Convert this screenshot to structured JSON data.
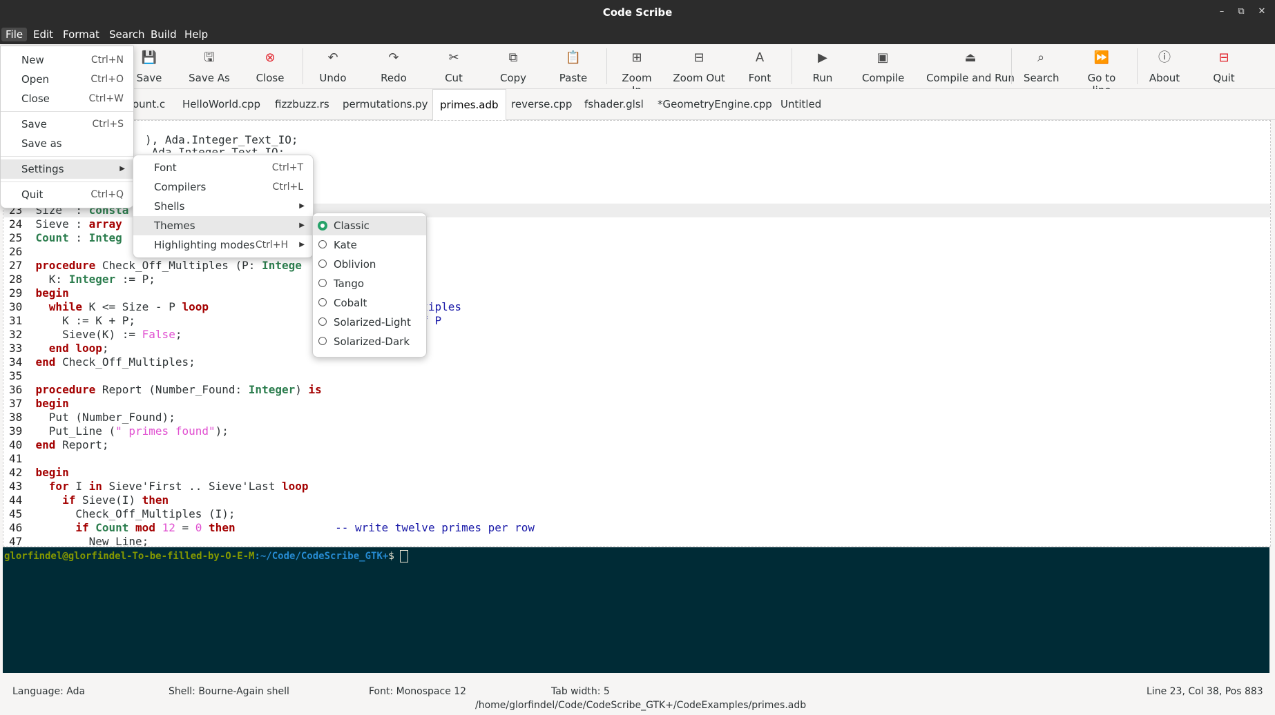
{
  "window": {
    "title": "Code Scribe",
    "minimize": "–",
    "maximize": "⧉",
    "close": "✕"
  },
  "menubar": [
    "File",
    "Edit",
    "Format",
    "Search",
    "Build",
    "Help"
  ],
  "toolbar": [
    {
      "label": "Save",
      "icon": "💾"
    },
    {
      "label": "Save As",
      "icon": "🖫"
    },
    {
      "label": "Close",
      "icon": "⊗"
    },
    {
      "label": "Undo",
      "icon": "↶"
    },
    {
      "label": "Redo",
      "icon": "↷"
    },
    {
      "label": "Cut",
      "icon": "✂"
    },
    {
      "label": "Copy",
      "icon": "⧉"
    },
    {
      "label": "Paste",
      "icon": "📋"
    },
    {
      "label": "Zoom In",
      "icon": "⊞"
    },
    {
      "label": "Zoom Out",
      "icon": "⊟"
    },
    {
      "label": "Font",
      "icon": "A"
    },
    {
      "label": "Run",
      "icon": "▶"
    },
    {
      "label": "Compile",
      "icon": "▣"
    },
    {
      "label": "Compile and Run",
      "icon": "⏏"
    },
    {
      "label": "Search",
      "icon": "⌕"
    },
    {
      "label": "Go to line",
      "icon": "⏩"
    },
    {
      "label": "About",
      "icon": "ⓘ"
    },
    {
      "label": "Quit",
      "icon": "⊟"
    }
  ],
  "tabs": [
    "ount.c",
    "HelloWorld.cpp",
    "fizzbuzz.rs",
    "permutations.py",
    "primes.adb",
    "reverse.cpp",
    "fshader.glsl",
    "*GeometryEngine.cpp",
    "Untitled"
  ],
  "active_tab": "primes.adb",
  "code_partial": {
    "l_top1": "), Ada.Integer_Text_IO;",
    "l_top2": " Ada.Integer_Text_IO;"
  },
  "file_menu": {
    "new": {
      "label": "New",
      "key": "Ctrl+N"
    },
    "open": {
      "label": "Open",
      "key": "Ctrl+O"
    },
    "close": {
      "label": "Close",
      "key": "Ctrl+W"
    },
    "save": {
      "label": "Save",
      "key": "Ctrl+S"
    },
    "saveas": {
      "label": "Save as",
      "key": ""
    },
    "settings": {
      "label": "Settings"
    },
    "quit": {
      "label": "Quit",
      "key": "Ctrl+Q"
    }
  },
  "settings_menu": {
    "font": {
      "label": "Font",
      "key": "Ctrl+T"
    },
    "compilers": {
      "label": "Compilers",
      "key": "Ctrl+L"
    },
    "shells": {
      "label": "Shells"
    },
    "themes": {
      "label": "Themes"
    },
    "highlighting": {
      "label": "Highlighting modes",
      "key": "Ctrl+H"
    }
  },
  "themes_menu": [
    {
      "label": "Classic",
      "selected": true
    },
    {
      "label": "Kate",
      "selected": false
    },
    {
      "label": "Oblivion",
      "selected": false
    },
    {
      "label": "Tango",
      "selected": false
    },
    {
      "label": "Cobalt",
      "selected": false
    },
    {
      "label": "Solarized-Light",
      "selected": false
    },
    {
      "label": "Solarized-Dark",
      "selected": false
    }
  ],
  "terminal": {
    "user": "glorfindel@glorfindel-To-be-filled-by-O-E-M",
    "path": ":~/Code/CodeScribe_GTK+",
    "dollar": "$ "
  },
  "statusbar": {
    "language": "Language: Ada",
    "shell": "Shell: Bourne-Again shell",
    "font": "Font: Monospace 12",
    "tabwidth": "Tab width: 5",
    "position": "Line 23,  Col 38,  Pos 883",
    "filepath": "/home/glorfindel/Code/CodeScribe_GTK+/CodeExamples/primes.adb"
  },
  "colors": {
    "terminal_bg": "#002b36",
    "theme_radio": "#26a269",
    "keyword": "#a40000",
    "type": "#2c7d4e"
  }
}
